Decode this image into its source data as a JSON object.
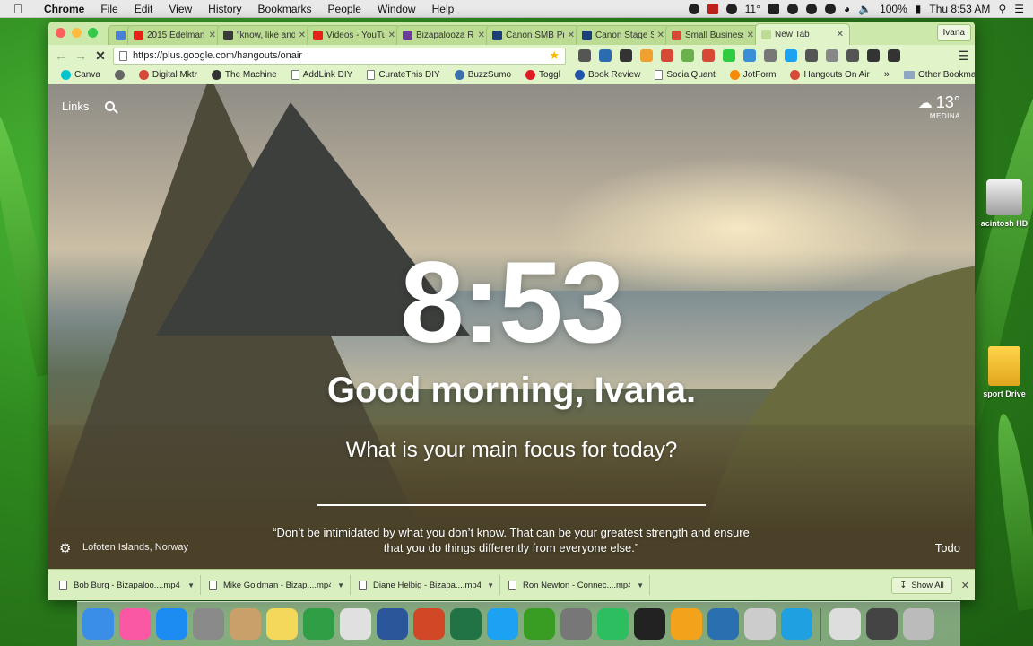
{
  "menubar": {
    "app_name": "Chrome",
    "items": [
      "File",
      "Edit",
      "View",
      "History",
      "Bookmarks",
      "People",
      "Window",
      "Help"
    ],
    "temperature": "11°",
    "battery": "100%",
    "clock": "Thu 8:53 AM"
  },
  "tabs": [
    {
      "label": "",
      "color": "#4a7fd9",
      "pinned": true
    },
    {
      "label": "2015 Edelman",
      "color": "#e62117"
    },
    {
      "label": "\"know, like and",
      "color": "#3a3a3a"
    },
    {
      "label": "Videos - YouTu",
      "color": "#e62117"
    },
    {
      "label": "Bizapalooza Ro",
      "color": "#6a3d9a"
    },
    {
      "label": "Canon SMB Pr",
      "color": "#1c3f7a"
    },
    {
      "label": "Canon Stage S",
      "color": "#1c3f7a"
    },
    {
      "label": "Small Business",
      "color": "#d64937"
    },
    {
      "label": "New Tab",
      "color": "#bcdc93",
      "active": true
    }
  ],
  "profile_name": "Ivana",
  "address_bar": {
    "url": "https://plus.google.com/hangouts/onair"
  },
  "extensions": [
    "#555555",
    "#2b6cb0",
    "#333333",
    "#f0a030",
    "#d64937",
    "#6ab04c",
    "#d64937",
    "#2ecc40",
    "#3a8ed6",
    "#777777",
    "#1da1f2",
    "#555555",
    "#888888",
    "#555555",
    "#333333",
    "#333333"
  ],
  "bookmarks": [
    {
      "label": "Canva",
      "color": "#00c4cc"
    },
    {
      "label": "",
      "color": "#666666"
    },
    {
      "label": "Digital Mktr",
      "color": "#d64937"
    },
    {
      "label": "The Machine",
      "color": "#333333"
    },
    {
      "label": "AddLink DIY",
      "color": "page"
    },
    {
      "label": "CurateThis DIY",
      "color": "page"
    },
    {
      "label": "BuzzSumo",
      "color": "#3a6fb0"
    },
    {
      "label": "Toggl",
      "color": "#e01b22"
    },
    {
      "label": "Book Review",
      "color": "#2255aa"
    },
    {
      "label": "SocialQuant",
      "color": "page"
    },
    {
      "label": "JotForm",
      "color": "#f58a07"
    },
    {
      "label": "Hangouts On Air",
      "color": "#d64937"
    }
  ],
  "bookmarks_more": "»",
  "other_bookmarks": "Other Bookmarks",
  "momentum": {
    "links_label": "Links",
    "temperature": "13°",
    "location": "MEDINA",
    "time": "8:53",
    "greeting": "Good morning, Ivana.",
    "focus_question": "What is your main focus for today?",
    "focus_value": "",
    "photo_location": "Lofoten Islands, Norway",
    "quote": "“Don’t be intimidated by what you don’t know. That can be your greatest strength and ensure that you do things differently from everyone else.”",
    "todo_label": "Todo"
  },
  "downloads": [
    {
      "label": "Bob Burg - Bizapaloo....mp4"
    },
    {
      "label": "Mike Goldman - Bizap....mp4"
    },
    {
      "label": "Diane Helbig - Bizapa....mp4"
    },
    {
      "label": "Ron Newton - Connec....mp4"
    }
  ],
  "show_all_label": "Show All",
  "desktop": {
    "hd_label": "acintosh HD",
    "drive_label": "sport Drive"
  },
  "dock_apps": [
    "#3a8ee6",
    "#fa57a4",
    "#1d8cf2",
    "#8a8a8a",
    "#c9a06a",
    "#f4d85a",
    "#2f9e44",
    "#e0e0e0",
    "#2b579a",
    "#d24726",
    "#217346",
    "#1da1f2",
    "#3a9d23",
    "#777777",
    "#2dbe60",
    "#222222",
    "#f3a21b",
    "#2a6fb0",
    "#cccccc",
    "#1fa0e0",
    "#dddddd",
    "#444444",
    "#bbbbbb"
  ]
}
